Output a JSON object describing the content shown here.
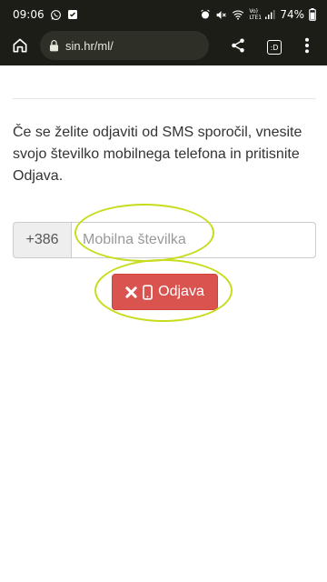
{
  "status_bar": {
    "time": "09:06",
    "battery": "74%",
    "network_label": "Vo) LTE1"
  },
  "browser": {
    "url": "sin.hr/ml/",
    "tab_count": ":D"
  },
  "page": {
    "instructions": "Če se želite odjaviti od SMS sporočil, vnesite svojo številko mobilnega telefona in pritisnite Odjava.",
    "country_code": "+386",
    "phone_placeholder": "Mobilna številka",
    "unsubscribe_label": "Odjava"
  },
  "icons": {
    "status_left": [
      "whatsapp-icon",
      "download-check-icon"
    ],
    "status_right": [
      "alarm-icon",
      "mute-icon",
      "wifi-icon",
      "signal-icon",
      "battery-icon"
    ],
    "toolbar": [
      "home-icon",
      "lock-icon",
      "share-icon",
      "tabs-icon",
      "more-vert-icon"
    ],
    "button": [
      "times-icon",
      "mobile-phone-icon"
    ]
  },
  "colors": {
    "toolbar_bg": "#1c1d17",
    "button_danger": "#d9534f",
    "highlight": "#c8dc1e"
  }
}
